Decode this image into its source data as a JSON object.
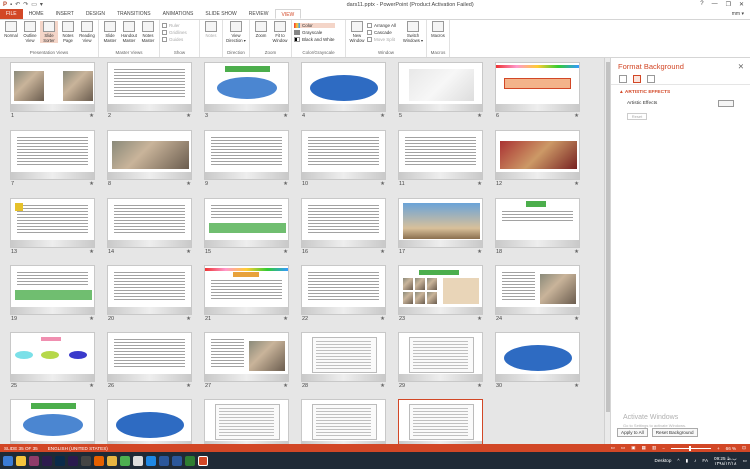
{
  "titlebar": {
    "title": "dars11.pptx - PowerPoint (Product Activation Failed)",
    "controls": [
      "?",
      "—",
      "❐",
      "✕"
    ]
  },
  "tabs": [
    "FILE",
    "HOME",
    "INSERT",
    "DESIGN",
    "TRANSITIONS",
    "ANIMATIONS",
    "SLIDE SHOW",
    "REVIEW",
    "VIEW"
  ],
  "active_tab": "VIEW",
  "user": "mm ▾",
  "ribbon": {
    "presentation_views": {
      "label": "Presentation Views",
      "buttons": [
        "Normal",
        "Outline View",
        "Slide Sorter",
        "Notes Page",
        "Reading View"
      ]
    },
    "master_views": {
      "label": "Master Views",
      "buttons": [
        "Slide Master",
        "Handout Master",
        "Notes Master"
      ]
    },
    "show": {
      "label": "Show",
      "items": [
        "Ruler",
        "Gridlines",
        "Guides"
      ]
    },
    "notes": {
      "label": "Notes"
    },
    "direction": {
      "label": "Direction",
      "button": "View Direction ▾"
    },
    "zoom": {
      "label": "Zoom",
      "buttons": [
        "Zoom",
        "Fit to Window"
      ]
    },
    "color": {
      "label": "Color/Grayscale",
      "items": [
        "Color",
        "Grayscale",
        "Black and White"
      ]
    },
    "window": {
      "label": "Window",
      "new_window": "New Window",
      "items": [
        "Arrange All",
        "Cascade",
        "Move Split"
      ],
      "switch": "Switch Windows ▾"
    },
    "macros": {
      "label": "Macros",
      "button": "Macros"
    }
  },
  "slides": [
    {
      "n": "1",
      "kind": "photo"
    },
    {
      "n": "2",
      "kind": "text"
    },
    {
      "n": "3",
      "kind": "ellipse-green"
    },
    {
      "n": "4",
      "kind": "ellipse"
    },
    {
      "n": "5",
      "kind": "blank"
    },
    {
      "n": "6",
      "kind": "title"
    },
    {
      "n": "7",
      "kind": "text"
    },
    {
      "n": "8",
      "kind": "photo-wide"
    },
    {
      "n": "9",
      "kind": "text"
    },
    {
      "n": "10",
      "kind": "text"
    },
    {
      "n": "11",
      "kind": "text"
    },
    {
      "n": "12",
      "kind": "photo-red"
    },
    {
      "n": "13",
      "kind": "text-yellow"
    },
    {
      "n": "14",
      "kind": "text"
    },
    {
      "n": "15",
      "kind": "text-green"
    },
    {
      "n": "16",
      "kind": "text"
    },
    {
      "n": "17",
      "kind": "photo-sky"
    },
    {
      "n": "18",
      "kind": "green-label"
    },
    {
      "n": "19",
      "kind": "text-green"
    },
    {
      "n": "20",
      "kind": "text"
    },
    {
      "n": "21",
      "kind": "orange-label"
    },
    {
      "n": "22",
      "kind": "text"
    },
    {
      "n": "23",
      "kind": "photo-grid"
    },
    {
      "n": "24",
      "kind": "photo-side"
    },
    {
      "n": "25",
      "kind": "shapes"
    },
    {
      "n": "26",
      "kind": "text"
    },
    {
      "n": "27",
      "kind": "photo-side"
    },
    {
      "n": "28",
      "kind": "table"
    },
    {
      "n": "29",
      "kind": "table"
    },
    {
      "n": "30",
      "kind": "ellipse"
    },
    {
      "n": "31",
      "kind": "ellipse-green"
    },
    {
      "n": "32",
      "kind": "ellipse"
    },
    {
      "n": "33",
      "kind": "table"
    },
    {
      "n": "34",
      "kind": "table"
    },
    {
      "n": "35",
      "kind": "table"
    }
  ],
  "selected_slide": "35",
  "star": "★",
  "pane": {
    "title": "Format Background",
    "close": "✕",
    "section": "▲ ARTISTIC EFFECTS",
    "artistic_effects_label": "Artistic Effects",
    "reset": "Reset",
    "activate_title": "Activate Windows",
    "activate_sub": "Go to Settings to activate Windows.",
    "apply_all": "Apply to All",
    "reset_background": "Reset Background"
  },
  "status": {
    "slide": "SLIDE 35 OF 35",
    "language": "ENGLISH (UNITED STATES)",
    "zoom": "66 %"
  },
  "taskbar": {
    "lang": "FA",
    "time": "09:25 ب.ظ",
    "date": "۱۳۹۸/۱۲/۱۸",
    "desktop": "Desktop"
  },
  "colors": {
    "accent": "#d24726",
    "taskbar": "#1f2a36"
  }
}
